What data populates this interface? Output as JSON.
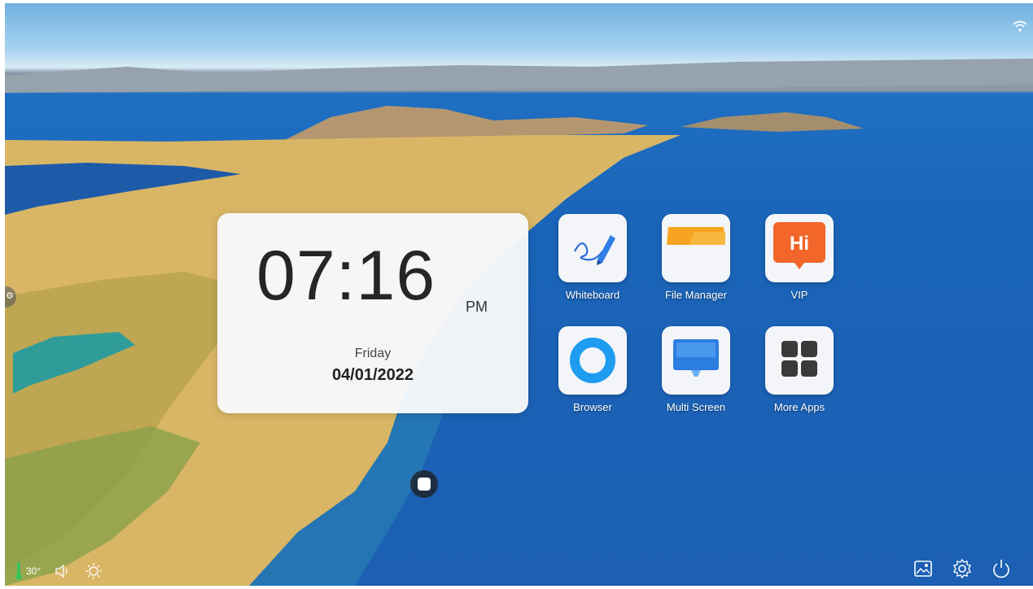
{
  "clock": {
    "time": "07:16",
    "ampm": "PM",
    "day": "Friday",
    "date": "04/01/2022"
  },
  "apps": [
    {
      "label": "Whiteboard",
      "icon": "whiteboard-icon"
    },
    {
      "label": "File Manager",
      "icon": "folder-icon"
    },
    {
      "label": "VIP",
      "icon": "hi-bubble-icon",
      "badge": "Hi"
    },
    {
      "label": "Browser",
      "icon": "browser-ring-icon"
    },
    {
      "label": "Multi Screen",
      "icon": "monitor-icon"
    },
    {
      "label": "More Apps",
      "icon": "grid-icon"
    }
  ],
  "status": {
    "temperature": "30°"
  },
  "colors": {
    "vip_orange": "#f2662a",
    "browser_blue": "#1e9cf0",
    "folder_orange": "#f7a520",
    "multiscreen_blue": "#2c7de0"
  }
}
